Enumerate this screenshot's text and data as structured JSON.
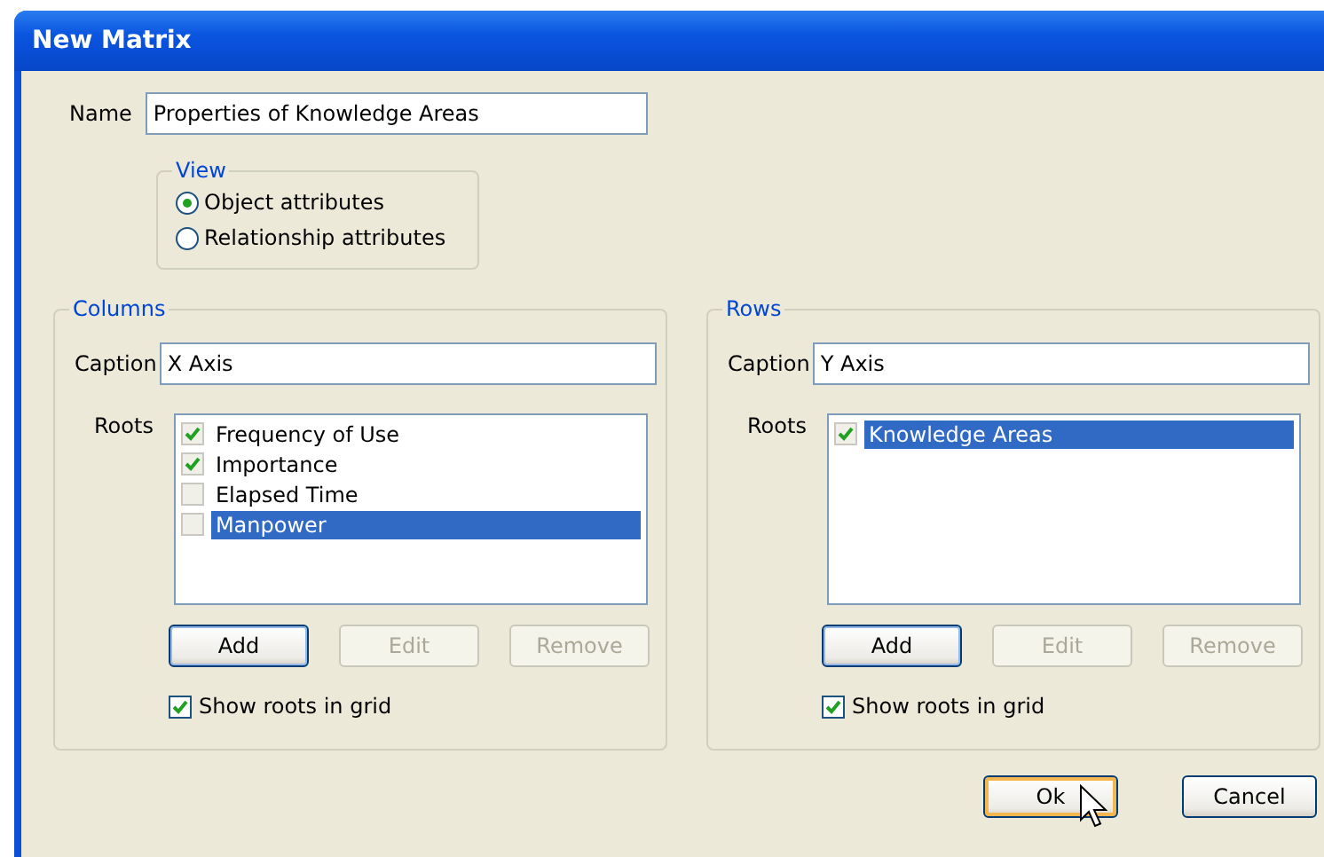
{
  "window": {
    "title": "New Matrix"
  },
  "name": {
    "label": "Name",
    "value": "Properties of Knowledge Areas"
  },
  "view": {
    "title": "View",
    "options": [
      {
        "label": "Object attributes",
        "selected": true
      },
      {
        "label": "Relationship attributes",
        "selected": false
      }
    ]
  },
  "groups": [
    {
      "title": "Columns",
      "caption_label": "Caption",
      "caption": "X Axis",
      "roots_label": "Roots",
      "roots": [
        {
          "label": "Frequency of Use",
          "checked": true,
          "selected": false
        },
        {
          "label": "Importance",
          "checked": true,
          "selected": false
        },
        {
          "label": "Elapsed Time",
          "checked": false,
          "selected": false
        },
        {
          "label": "Manpower",
          "checked": false,
          "selected": true
        }
      ],
      "buttons": [
        {
          "label": "Add",
          "disabled": false
        },
        {
          "label": "Edit",
          "disabled": true
        },
        {
          "label": "Remove",
          "disabled": true
        }
      ],
      "show_roots": {
        "label": "Show roots in grid",
        "checked": true
      }
    },
    {
      "title": "Rows",
      "caption_label": "Caption",
      "caption": "Y Axis",
      "roots_label": "Roots",
      "roots": [
        {
          "label": "Knowledge Areas",
          "checked": true,
          "selected": true
        }
      ],
      "buttons": [
        {
          "label": "Add",
          "disabled": false
        },
        {
          "label": "Edit",
          "disabled": true
        },
        {
          "label": "Remove",
          "disabled": true
        }
      ],
      "show_roots": {
        "label": "Show roots in grid",
        "checked": true
      }
    }
  ],
  "footer_buttons": [
    {
      "label": "Ok",
      "hovered": true
    },
    {
      "label": "Cancel",
      "hovered": false
    }
  ]
}
